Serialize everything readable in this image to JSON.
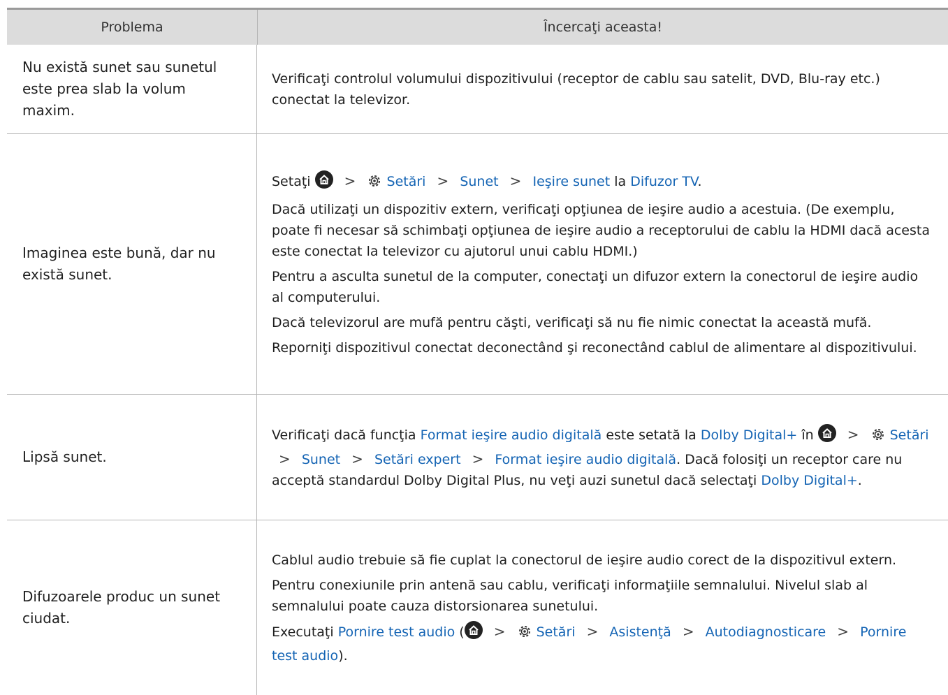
{
  "header": {
    "col1": "Problema",
    "col2": "Încercaţi aceasta!"
  },
  "rows": [
    {
      "problem": "Nu există sunet sau sunetul este prea slab la volum maxim.",
      "p1": "Verificaţi controlul volumului dispozitivului (receptor de cablu sau satelit, DVD, Blu-ray etc.) conectat la televizor."
    },
    {
      "problem": "Imaginea este bună, dar nu există sunet.",
      "path_prefix": "Setaţi",
      "settings": "Setări",
      "sound": "Sunet",
      "sound_output": "Ieşire sunet",
      "la": "la",
      "tv_speaker": "Difuzor TV",
      "end": ".",
      "p2": "Dacă utilizaţi un dispozitiv extern, verificaţi opţiunea de ieşire audio a acestuia. (De exemplu, poate fi necesar să schimbaţi opţiunea de ieşire audio a receptorului de cablu la HDMI dacă acesta este conectat la televizor cu ajutorul unui cablu HDMI.)",
      "p3": "Pentru a asculta sunetul de la computer, conectaţi un difuzor extern la conectorul de ieşire audio al computerului.",
      "p4": "Dacă televizorul are mufă pentru căşti, verificaţi să nu fie nimic conectat la această mufă.",
      "p5": "Reporniţi dispozitivul conectat deconectând şi reconectând cablul de alimentare al dispozitivului."
    },
    {
      "problem": "Lipsă sunet.",
      "t1": "Verificaţi dacă funcţia",
      "digital_format": "Format ieşire audio digitală",
      "t2": "este setată la",
      "dolby": "Dolby Digital+",
      "t3": "în",
      "settings": "Setări",
      "sound": "Sunet",
      "expert": "Setări expert",
      "digital_format2": "Format ieşire audio digitală",
      "t4": ". Dacă folosiţi un receptor care nu acceptă standardul Dolby Digital Plus, nu veţi auzi sunetul dacă selectaţi",
      "dolby2": "Dolby Digital+",
      "end": "."
    },
    {
      "problem": "Difuzoarele produc un sunet ciudat.",
      "p1": "Cablul audio trebuie să fie cuplat la conectorul de ieşire audio corect de la dispozitivul extern.",
      "p2": "Pentru conexiunile prin antenă sau cablu, verificaţi informaţiile semnalului. Nivelul slab al semnalului poate cauza distorsionarea sunetului.",
      "e1": "Executaţi",
      "test": "Pornire test audio",
      "open": "(",
      "settings": "Setări",
      "support": "Asistenţă",
      "selfdiag": "Autodiagnosticare",
      "test2": "Pornire test audio",
      "close": ")."
    }
  ]
}
